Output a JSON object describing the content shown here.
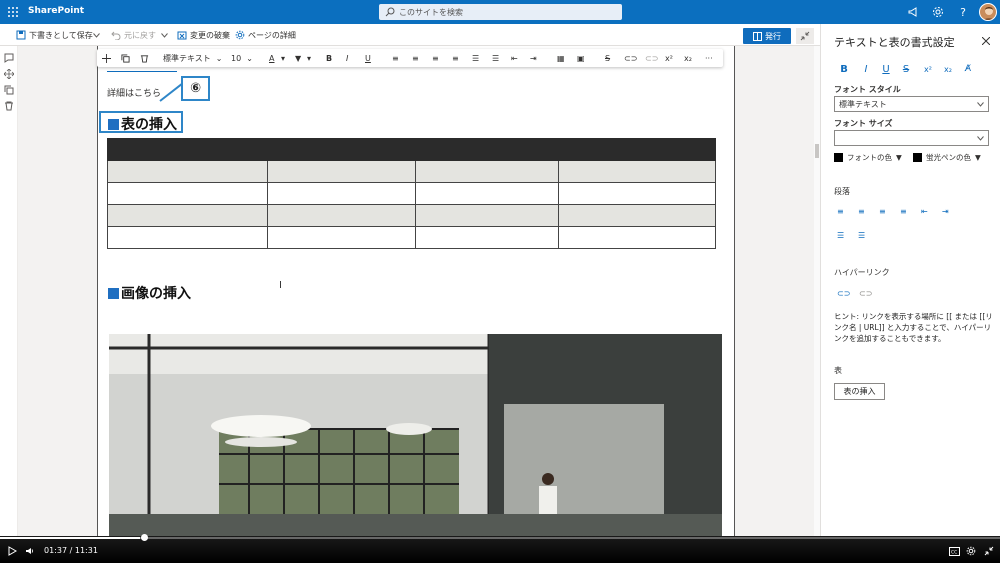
{
  "app": {
    "name": "SharePoint"
  },
  "search": {
    "placeholder": "このサイトを検索"
  },
  "toolbar": {
    "save_draft": "下書きとして保存",
    "undo": "元に戻す",
    "discard": "変更の破棄",
    "page_details": "ページの詳細",
    "publish": "発行"
  },
  "rte": {
    "style": "標準テキスト",
    "size": "10"
  },
  "content": {
    "detail_text": "詳細はこちら",
    "callout_number": "⑥",
    "heading_table": "表の挿入",
    "heading_image": "画像の挿入"
  },
  "pane": {
    "title": "テキストと表の書式設定",
    "font_style_label": "フォント スタイル",
    "font_style_value": "標準テキスト",
    "font_size_label": "フォント サイズ",
    "font_color": "フォントの色",
    "highlight_color": "蛍光ペンの色",
    "paragraph_label": "段落",
    "hyperlink_label": "ハイパーリンク",
    "hint": "ヒント: リンクを表示する場所に [[ または [[リンク名 | URL]] と入力することで、ハイパーリンクを追加することもできます。",
    "table_label": "表",
    "insert_table": "表の挿入"
  },
  "video": {
    "current": "01:37",
    "separator": "/",
    "total": "11:31",
    "progress": 0.14
  },
  "colors": {
    "brand": "#0b6fbf",
    "accent": "#0f6cbd",
    "callout": "#2e86c8",
    "table_header": "#2b2b2b",
    "table_shade": "#e4e4e0"
  }
}
